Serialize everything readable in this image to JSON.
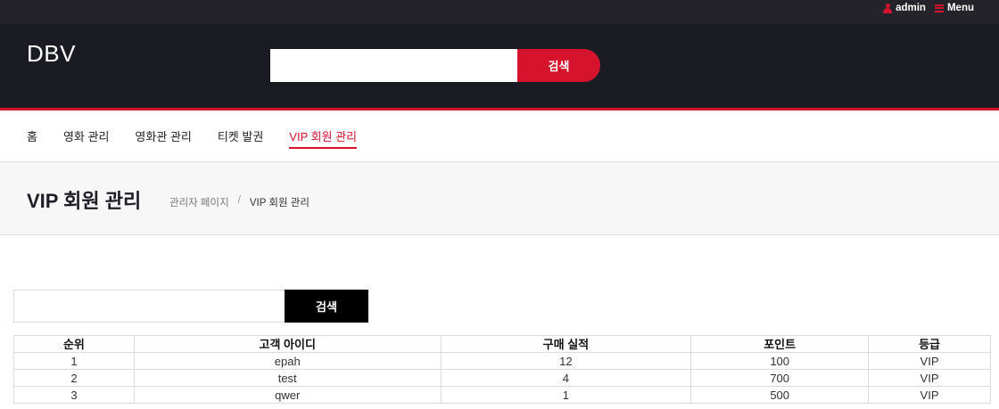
{
  "topbar": {
    "user_label": "admin",
    "menu_label": "Menu"
  },
  "header": {
    "logo": "DBV",
    "search_value": "",
    "search_button": "검색"
  },
  "nav": {
    "items": [
      {
        "label": "홈"
      },
      {
        "label": "영화 관리"
      },
      {
        "label": "영화관 관리"
      },
      {
        "label": "티켓 발권"
      },
      {
        "label": "VIP 회원 관리"
      }
    ],
    "active_index": 4
  },
  "titlebar": {
    "title": "VIP 회원 관리",
    "breadcrumb": [
      "관리자 페이지",
      "VIP 회원 관리"
    ],
    "separator": "/"
  },
  "content": {
    "search_value": "",
    "search_button": "검색",
    "table": {
      "headers": [
        "순위",
        "고객 아이디",
        "구매 실적",
        "포인트",
        "등급"
      ],
      "rows": [
        [
          "1",
          "epah",
          "12",
          "100",
          "VIP"
        ],
        [
          "2",
          "test",
          "4",
          "700",
          "VIP"
        ],
        [
          "3",
          "qwer",
          "1",
          "500",
          "VIP"
        ]
      ]
    }
  },
  "colors": {
    "accent": "#d6132c",
    "header_bg": "#1b1b23",
    "topbar_bg": "#232329"
  },
  "icons": [
    "user-icon",
    "menu-icon"
  ]
}
